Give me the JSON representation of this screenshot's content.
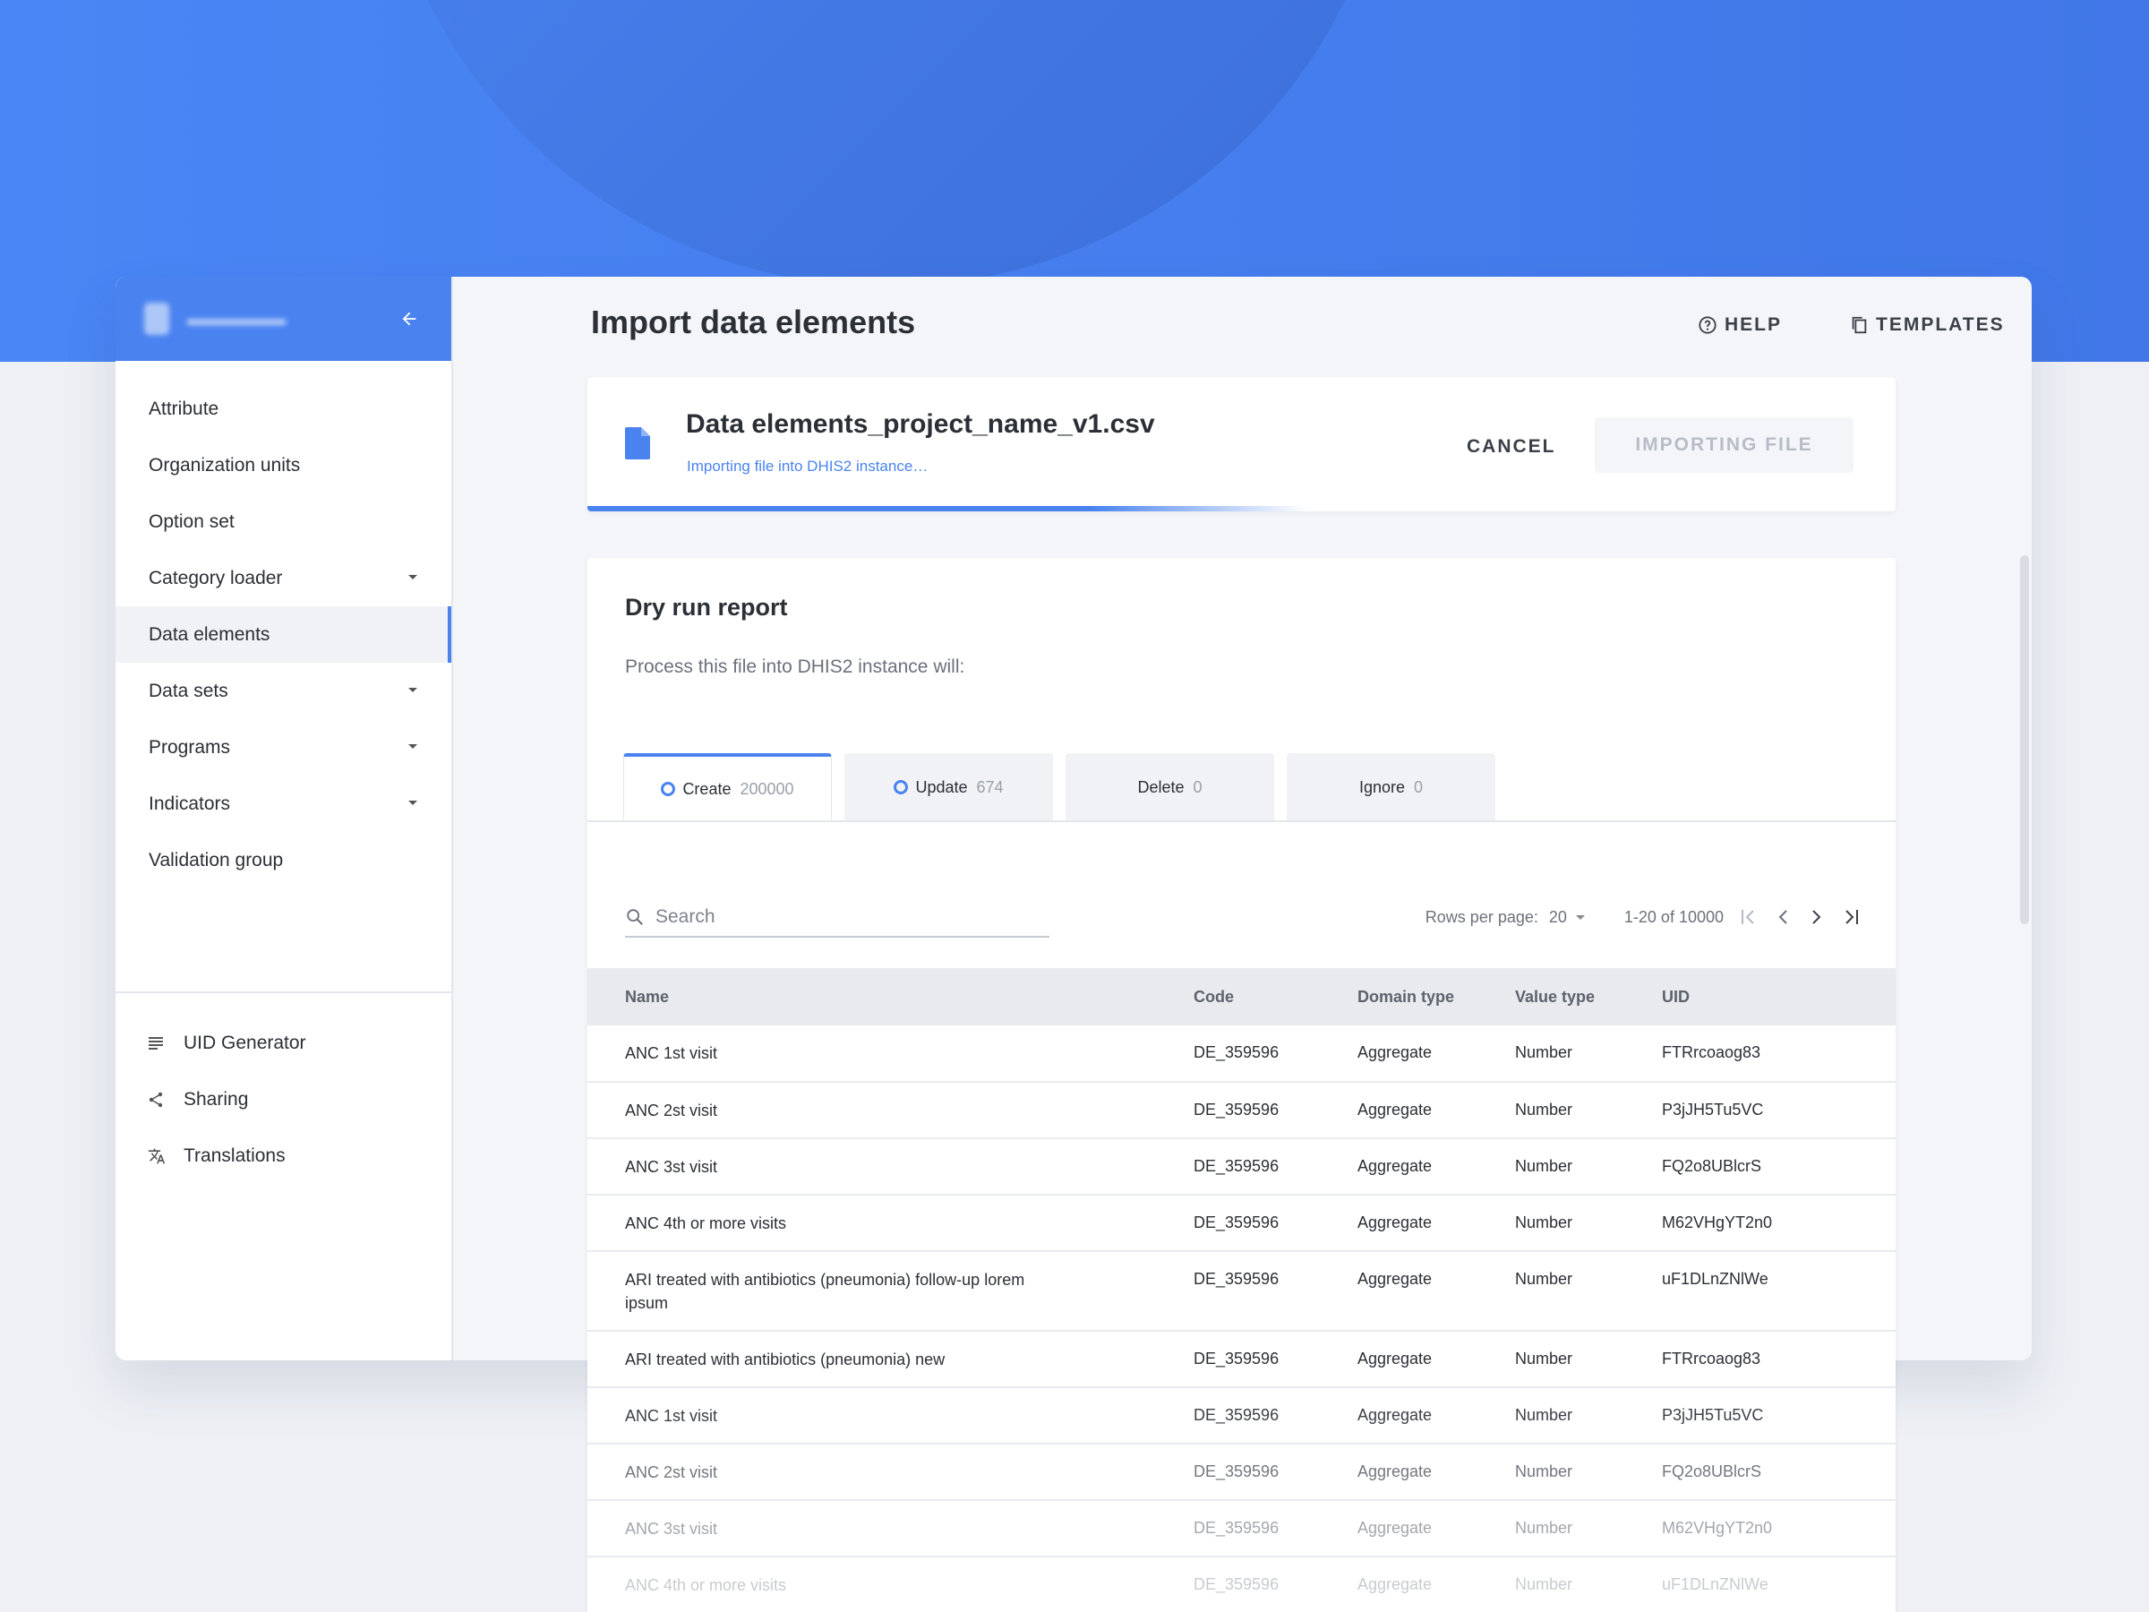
{
  "app": {
    "collapse_icon": "arrow-left-icon"
  },
  "sidebar": {
    "items": [
      {
        "label": "Attribute",
        "has_caret": false,
        "active": false
      },
      {
        "label": "Organization units",
        "has_caret": false,
        "active": false
      },
      {
        "label": "Option set",
        "has_caret": false,
        "active": false
      },
      {
        "label": "Category loader",
        "has_caret": true,
        "active": false
      },
      {
        "label": "Data elements",
        "has_caret": false,
        "active": true
      },
      {
        "label": "Data sets",
        "has_caret": true,
        "active": false
      },
      {
        "label": "Programs",
        "has_caret": true,
        "active": false
      },
      {
        "label": "Indicators",
        "has_caret": true,
        "active": false
      },
      {
        "label": "Validation group",
        "has_caret": false,
        "active": false
      }
    ],
    "tools": [
      {
        "label": "UID Generator",
        "icon": "list-icon"
      },
      {
        "label": "Sharing",
        "icon": "share-icon"
      },
      {
        "label": "Translations",
        "icon": "translate-icon"
      }
    ]
  },
  "header": {
    "title": "Import data elements",
    "help_label": "HELP",
    "templates_label": "TEMPLATES"
  },
  "file": {
    "name": "Data elements_project_name_v1.csv",
    "status": "Importing file into DHIS2 instance…",
    "cancel_label": "CANCEL",
    "import_label": "IMPORTING FILE",
    "progress": 0.55,
    "accent": "#4a83f0"
  },
  "report": {
    "title": "Dry run report",
    "subtitle": "Process this file into DHIS2 instance will:",
    "tabs": [
      {
        "label": "Create",
        "count": "200000",
        "active": true,
        "ring": true
      },
      {
        "label": "Update",
        "count": "674",
        "active": false,
        "ring": true
      },
      {
        "label": "Delete",
        "count": "0",
        "active": false,
        "ring": false
      },
      {
        "label": "Ignore",
        "count": "0",
        "active": false,
        "ring": false
      }
    ],
    "search_placeholder": "Search",
    "rows_per_page_label": "Rows per page:",
    "rows_per_page_value": "20",
    "range": "1-20 of 10000",
    "columns": [
      "Name",
      "Code",
      "Domain type",
      "Value type",
      "UID"
    ],
    "rows": [
      [
        "ANC 1st visit",
        "DE_359596",
        "Aggregate",
        "Number",
        "FTRrcoaog83"
      ],
      [
        "ANC 2st visit",
        "DE_359596",
        "Aggregate",
        "Number",
        "P3jJH5Tu5VC"
      ],
      [
        "ANC 3st visit",
        "DE_359596",
        "Aggregate",
        "Number",
        "FQ2o8UBlcrS"
      ],
      [
        "ANC 4th or more visits",
        "DE_359596",
        "Aggregate",
        "Number",
        "M62VHgYT2n0"
      ],
      [
        "ARI treated with antibiotics (pneumonia) follow-up lorem ipsum",
        "DE_359596",
        "Aggregate",
        "Number",
        "uF1DLnZNlWe"
      ],
      [
        "ARI treated with antibiotics (pneumonia) new",
        "DE_359596",
        "Aggregate",
        "Number",
        "FTRrcoaog83"
      ],
      [
        "ANC 1st visit",
        "DE_359596",
        "Aggregate",
        "Number",
        "P3jJH5Tu5VC"
      ],
      [
        "ANC 2st visit",
        "DE_359596",
        "Aggregate",
        "Number",
        "FQ2o8UBlcrS"
      ],
      [
        "ANC 3st visit",
        "DE_359596",
        "Aggregate",
        "Number",
        "M62VHgYT2n0"
      ],
      [
        "ANC 4th or more visits",
        "DE_359596",
        "Aggregate",
        "Number",
        "uF1DLnZNlWe"
      ]
    ]
  }
}
